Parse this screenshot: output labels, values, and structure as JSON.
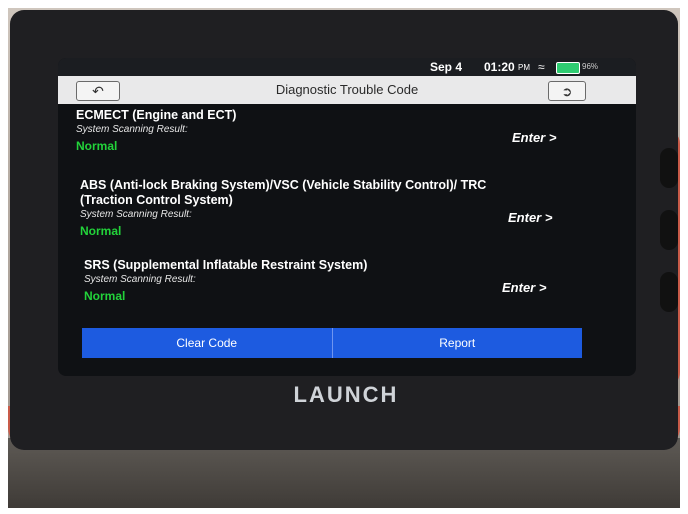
{
  "status_bar": {
    "date": "Sep 4",
    "time": "01:20",
    "ampm": "PM",
    "battery": "96%"
  },
  "title_bar": {
    "title": "Diagnostic Trouble Code",
    "back_icon": "back-arrow-icon",
    "exit_icon": "exit-icon"
  },
  "systems": [
    {
      "name": "ECMECT (Engine and ECT)",
      "scan_label": "System Scanning Result:",
      "result": "Normal",
      "enter": "Enter >"
    },
    {
      "name": "ABS (Anti-lock Braking System)/VSC (Vehicle Stability Control)/ TRC (Traction Control System)",
      "scan_label": "System Scanning Result:",
      "result": "Normal",
      "enter": "Enter >"
    },
    {
      "name": "SRS (Supplemental Inflatable Restraint System)",
      "scan_label": "System Scanning Result:",
      "result": "Normal",
      "enter": "Enter >"
    }
  ],
  "actions": {
    "clear_code": "Clear Code",
    "report": "Report"
  },
  "brand": "LAUNCH",
  "colors": {
    "accent_blue": "#1d5be0",
    "normal_green": "#22d33a",
    "device_red": "#c95b49"
  }
}
